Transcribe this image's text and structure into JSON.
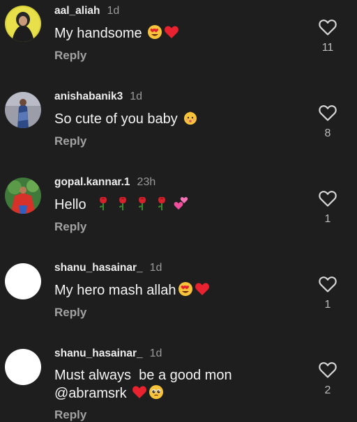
{
  "comments": [
    {
      "username": "aal_aliah",
      "time": "1d",
      "text": "My handsome",
      "emoji": [
        "smiling-face-with-heart-eyes-emoji",
        "red-heart-emoji"
      ],
      "reply": "Reply",
      "likes": "11"
    },
    {
      "username": "anishabanik3",
      "time": "1d",
      "text": "So cute of you baby",
      "emoji": [
        "baby-emoji"
      ],
      "reply": "Reply",
      "likes": "8"
    },
    {
      "username": "gopal.kannar.1",
      "time": "23h",
      "text": "Hello",
      "emoji": [
        "rose-emoji",
        "rose-emoji",
        "rose-emoji",
        "rose-emoji",
        "two-hearts-emoji"
      ],
      "reply": "Reply",
      "likes": "1"
    },
    {
      "username": "shanu_hasainar_",
      "time": "1d",
      "text": "My hero mash allah",
      "emoji": [
        "smiling-face-with-heart-eyes-emoji",
        "red-heart-emoji"
      ],
      "reply": "Reply",
      "likes": "1"
    },
    {
      "username": "shanu_hasainar_",
      "time": "1d",
      "text": "Must always  be a good mon",
      "text_line2": "@abramsrk",
      "emoji": [
        "red-heart-emoji",
        "pleading-face-emoji"
      ],
      "reply": "Reply",
      "likes": "2"
    }
  ],
  "colors": {
    "background": "#1e1e1e",
    "text": "#f4f4f4",
    "muted": "#9a9a9a",
    "heart": "#e8222e"
  }
}
